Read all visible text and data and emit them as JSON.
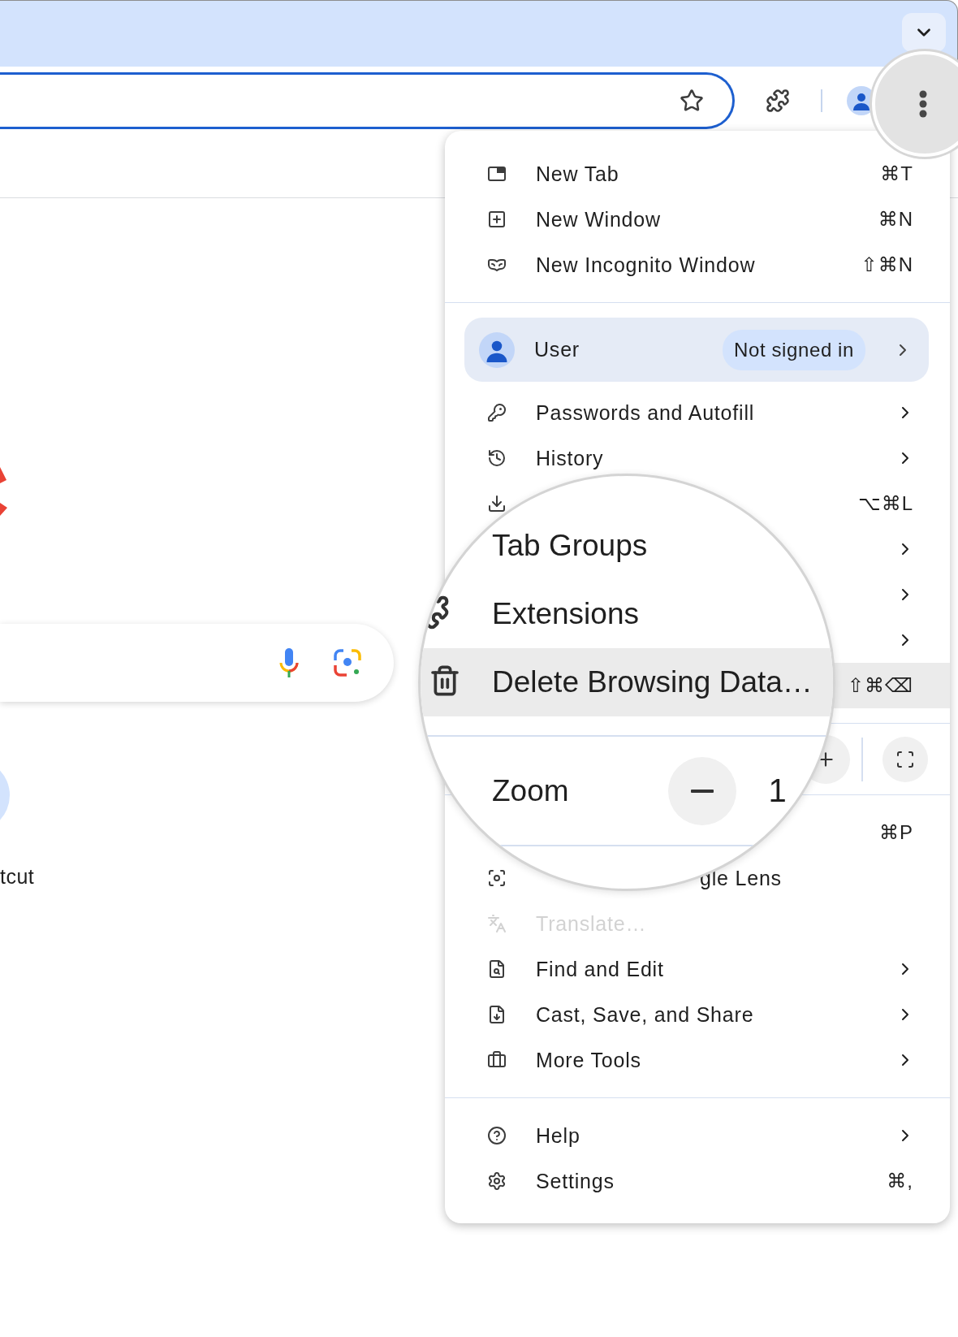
{
  "page": {
    "shortcut_label": "tcut"
  },
  "menu": {
    "sections": [
      {
        "kind": "list",
        "items": [
          {
            "kind": "item",
            "label": "New Tab",
            "shortcut": "⌘T",
            "submenu": false,
            "highlighted": false,
            "disabled": false
          },
          {
            "kind": "item",
            "label": "New Window",
            "shortcut": "⌘N",
            "submenu": false,
            "highlighted": false,
            "disabled": false
          },
          {
            "kind": "item",
            "label": "New Incognito Window",
            "shortcut": "⇧⌘N",
            "submenu": false,
            "highlighted": false,
            "disabled": false
          }
        ]
      },
      {
        "kind": "list",
        "items": [
          {
            "kind": "profile",
            "label": "User",
            "badge": "Not signed in",
            "submenu": true,
            "highlighted": false,
            "disabled": false
          },
          {
            "kind": "item",
            "label": "Passwords and Autofill",
            "submenu": true,
            "highlighted": false,
            "disabled": false
          },
          {
            "kind": "item",
            "label": "History",
            "submenu": true,
            "highlighted": false,
            "disabled": false
          },
          {
            "kind": "item",
            "shortcut": "⌥⌘L",
            "submenu": false,
            "highlighted": false,
            "disabled": false
          },
          {
            "kind": "item",
            "submenu": true,
            "highlighted": false,
            "disabled": false
          },
          {
            "kind": "item",
            "submenu": true,
            "highlighted": false,
            "disabled": false
          },
          {
            "kind": "item",
            "submenu": true,
            "highlighted": false,
            "disabled": false
          },
          {
            "kind": "item",
            "shortcut": "⇧⌘⌫",
            "submenu": false,
            "highlighted": true,
            "disabled": false
          }
        ]
      },
      {
        "kind": "zoom"
      },
      {
        "kind": "list",
        "items": [
          {
            "kind": "item",
            "shortcut": "⌘P",
            "submenu": false,
            "highlighted": false,
            "disabled": false
          },
          {
            "kind": "cut_label",
            "label": "gle Lens",
            "submenu": false,
            "highlighted": false,
            "disabled": false
          },
          {
            "kind": "item",
            "label": "Translate…",
            "submenu": false,
            "highlighted": false,
            "disabled": true
          },
          {
            "kind": "item",
            "label": "Find and Edit",
            "submenu": true,
            "highlighted": false,
            "disabled": false
          },
          {
            "kind": "item",
            "label": "Cast, Save, and Share",
            "submenu": true,
            "highlighted": false,
            "disabled": false
          },
          {
            "kind": "item",
            "label": "More Tools",
            "submenu": true,
            "highlighted": false,
            "disabled": false
          }
        ]
      },
      {
        "kind": "list",
        "items": [
          {
            "kind": "item",
            "label": "Help",
            "submenu": true,
            "highlighted": false,
            "disabled": false
          },
          {
            "kind": "item",
            "label": "Settings",
            "shortcut": "⌘,",
            "submenu": false,
            "highlighted": false,
            "disabled": false
          }
        ]
      }
    ]
  },
  "magnifier": {
    "rows": [
      {
        "label": "Tab Groups",
        "highlighted": false
      },
      {
        "label": "Extensions",
        "highlighted": false
      },
      {
        "label": "Delete Browsing Data…",
        "highlighted": true
      }
    ],
    "zoom": {
      "label": "Zoom",
      "value": "1"
    }
  }
}
